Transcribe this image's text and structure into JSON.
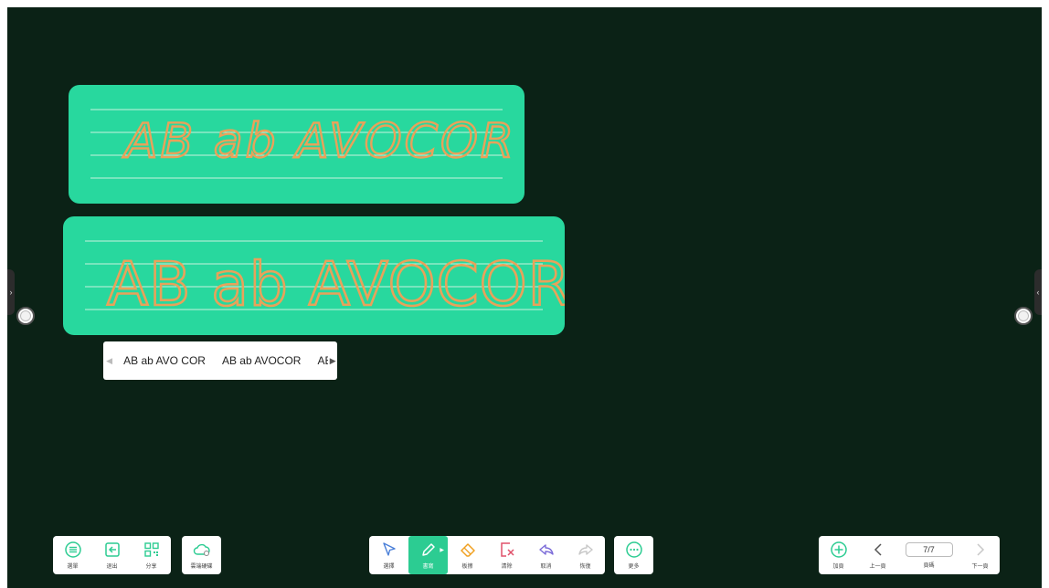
{
  "cards": [
    {
      "text": "AB ab AVOCOR",
      "style": "upright"
    },
    {
      "text": "AB ab AVOCOR",
      "style": "cursive"
    }
  ],
  "candidates": {
    "items": [
      "AB ab AVO COR",
      "AB ab AVOCOR",
      "AE"
    ],
    "prev_icon": "triangle-left-icon",
    "next_icon": "triangle-right-icon"
  },
  "toolbar_left": {
    "menu": "選單",
    "exit": "退出",
    "share": "分享"
  },
  "toolbar_cloud": {
    "cloud": "雲端硬碟"
  },
  "toolbar_center": {
    "select": "選擇",
    "write": "書寫",
    "eraser": "板擦",
    "clear": "清除",
    "undo": "取消",
    "redo": "恢復"
  },
  "toolbar_more": {
    "more": "更多"
  },
  "toolbar_pages": {
    "add": "加頁",
    "prev": "上一頁",
    "page_indicator": "7/7",
    "page_label": "頁碼",
    "next": "下一頁"
  },
  "colors": {
    "board": "#0b2216",
    "card": "#28d89e",
    "ink": "#e8a25a",
    "accent": "#2ccc92"
  }
}
